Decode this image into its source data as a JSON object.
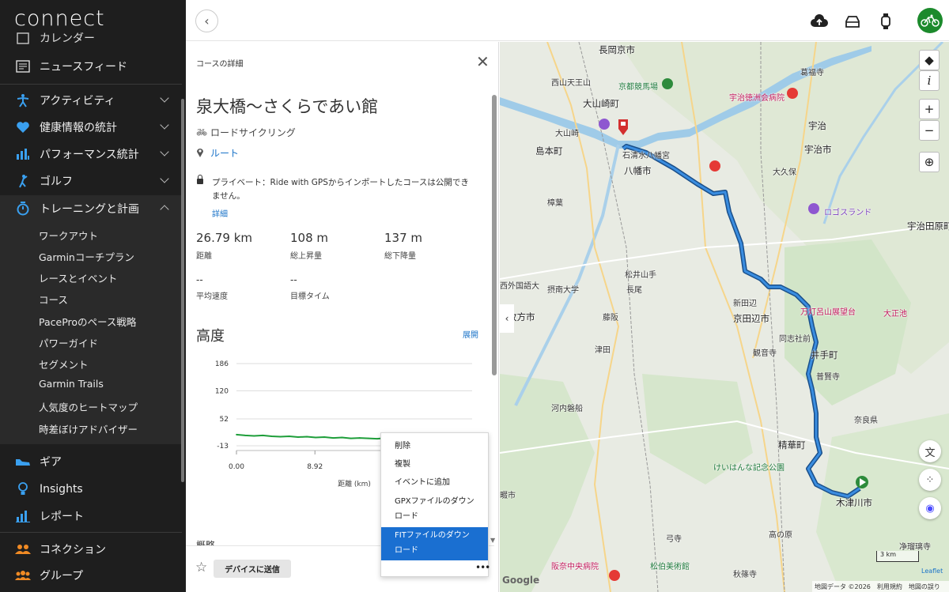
{
  "app": {
    "logo": "connect"
  },
  "sidebar": {
    "partial_item": "カレンダー",
    "items": [
      {
        "label": "ニュースフィード",
        "icon": "newsfeed-icon"
      },
      {
        "label": "アクティビティ",
        "icon": "activity-icon"
      },
      {
        "label": "健康情報の統計",
        "icon": "heart-icon"
      },
      {
        "label": "パフォーマンス統計",
        "icon": "performance-icon"
      },
      {
        "label": "ゴルフ",
        "icon": "golf-icon"
      },
      {
        "label": "トレーニングと計画",
        "icon": "stopwatch-icon"
      }
    ],
    "sub_items": [
      "ワークアウト",
      "Garminコーチプラン",
      "レースとイベント",
      "コース",
      "PaceProのペース戦略",
      "パワーガイド",
      "セグメント",
      "Garmin Trails",
      "人気度のヒートマップ",
      "時差ぼけアドバイザー"
    ],
    "bottom_items": [
      {
        "label": "ギア",
        "icon": "shoe-icon"
      },
      {
        "label": "Insights",
        "icon": "lightbulb-icon"
      },
      {
        "label": "レポート",
        "icon": "report-icon"
      },
      {
        "label": "コネクション",
        "icon": "connections-icon"
      },
      {
        "label": "グループ",
        "icon": "groups-icon"
      }
    ]
  },
  "topbar": {
    "icons": [
      "upload-icon",
      "inbox-icon",
      "device-icon",
      "avatar"
    ]
  },
  "panel": {
    "header": "コースの詳細",
    "title": "泉大橋〜さくらであい館",
    "activity_type": "ロードサイクリング",
    "route_link": "ルート",
    "privacy": "プライベート：Ride with GPSからインポートしたコースは公開できません。",
    "details_link": "詳細",
    "stats": [
      {
        "value": "26.79 km",
        "label": "距離"
      },
      {
        "value": "108 m",
        "label": "総上昇量"
      },
      {
        "value": "137 m",
        "label": "総下降量"
      },
      {
        "value": "--",
        "label": "平均速度"
      },
      {
        "value": "--",
        "label": "目標タイム"
      }
    ],
    "elevation_title": "高度",
    "expand_link": "展開",
    "next_section": "概略",
    "send_button": "デバイスに送信"
  },
  "chart_data": {
    "type": "line",
    "title": "",
    "xlabel": "距離 (km)",
    "ylabel": "",
    "y_ticks": [
      186,
      120,
      52,
      -13
    ],
    "x_ticks": [
      0.0,
      8.92
    ],
    "x_tick_labels": [
      "0.00",
      "8.92"
    ],
    "ylim": [
      -13,
      186
    ],
    "xlim": [
      0,
      26.79
    ],
    "series": [
      {
        "color": "#1e9e3a",
        "x": [
          0,
          1,
          2,
          3,
          4,
          5,
          6,
          7,
          8,
          9,
          10,
          11,
          12,
          13,
          14,
          15,
          16,
          17,
          18,
          19,
          20,
          21,
          22,
          23,
          24,
          25,
          26,
          26.79
        ],
        "y": [
          14,
          12,
          11,
          12,
          10,
          9,
          10,
          8,
          9,
          7,
          8,
          6,
          7,
          5,
          6,
          5,
          4,
          6,
          5,
          4,
          5,
          3,
          4,
          3,
          4,
          3,
          2,
          2
        ]
      }
    ]
  },
  "menu": {
    "items": [
      "削除",
      "複製",
      "イベントに追加",
      "GPXファイルのダウンロード",
      "FITファイルのダウンロード"
    ],
    "selected": 4,
    "more": "•••"
  },
  "map": {
    "labels": [
      {
        "t": "長岡京市",
        "cls": "big"
      },
      {
        "t": "西山天王山",
        "cls": ""
      },
      {
        "t": "京都競馬場",
        "cls": "green"
      },
      {
        "t": "大山崎町",
        "cls": "big"
      },
      {
        "t": "大山崎",
        "cls": ""
      },
      {
        "t": "石清水八幡宮",
        "cls": ""
      },
      {
        "t": "島本町",
        "cls": "big"
      },
      {
        "t": "八幡市",
        "cls": "big"
      },
      {
        "t": "宇治徳洲会病院",
        "cls": "poi"
      },
      {
        "t": "宇治",
        "cls": "big"
      },
      {
        "t": "宇治市",
        "cls": "big"
      },
      {
        "t": "大久保",
        "cls": ""
      },
      {
        "t": "樟葉",
        "cls": ""
      },
      {
        "t": "ロゴスランド",
        "cls": "purple"
      },
      {
        "t": "宇治田原町",
        "cls": "big"
      },
      {
        "t": "松井山手",
        "cls": ""
      },
      {
        "t": "長尾",
        "cls": ""
      },
      {
        "t": "摂南大学",
        "cls": ""
      },
      {
        "t": "藤阪",
        "cls": ""
      },
      {
        "t": "新田辺",
        "cls": ""
      },
      {
        "t": "京田辺市",
        "cls": "big"
      },
      {
        "t": "万灯呂山展望台",
        "cls": "poi"
      },
      {
        "t": "大正池",
        "cls": "poi"
      },
      {
        "t": "枚方市",
        "cls": "big"
      },
      {
        "t": "同志社前",
        "cls": ""
      },
      {
        "t": "井手町",
        "cls": "big"
      },
      {
        "t": "津田",
        "cls": ""
      },
      {
        "t": "観音寺",
        "cls": ""
      },
      {
        "t": "普賢寺",
        "cls": ""
      },
      {
        "t": "河内磐船",
        "cls": ""
      },
      {
        "t": "精華町",
        "cls": "big"
      },
      {
        "t": "けいはんな記念公園",
        "cls": "green"
      },
      {
        "t": "木津川市",
        "cls": "big"
      },
      {
        "t": "高の原",
        "cls": ""
      },
      {
        "t": "松伯美術館",
        "cls": "green"
      },
      {
        "t": "阪奈中央病院",
        "cls": "poi"
      },
      {
        "t": "秋篠寺",
        "cls": ""
      },
      {
        "t": "净瑠璃寺",
        "cls": ""
      },
      {
        "t": "葛福寺",
        "cls": ""
      },
      {
        "t": "弓寺",
        "cls": ""
      },
      {
        "t": "西外国語大",
        "cls": ""
      },
      {
        "t": "畷市",
        "cls": ""
      },
      {
        "t": "奈良県",
        "cls": ""
      }
    ],
    "collapse": "‹",
    "scale": "3 km",
    "leaflet": "Leaflet",
    "attribution": [
      "地図データ ©2026",
      "利用規約",
      "地図の誤り"
    ],
    "google": "Google",
    "controls": {
      "zoom_in": "+",
      "zoom_out": "−",
      "info": "i"
    }
  }
}
